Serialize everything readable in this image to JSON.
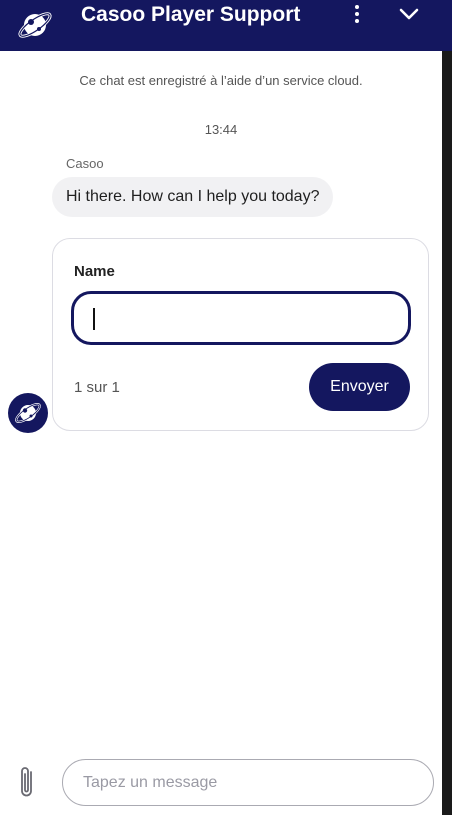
{
  "header": {
    "title": "Casoo Player Support",
    "logo_icon": "planet-logo-icon",
    "menu_icon": "kebab-menu-icon",
    "collapse_icon": "chevron-down-icon",
    "background": "#14175f"
  },
  "chat": {
    "notice": "Ce chat est enregistré à l’aide d’un service cloud.",
    "time": "13:44",
    "sender": "Casoo",
    "message": "Hi there. How can I help you today?",
    "avatar_icon": "planet-logo-icon"
  },
  "form": {
    "label": "Name",
    "input_value": "",
    "pager": "1 sur 1",
    "submit_label": "Envoyer",
    "accent": "#14175f"
  },
  "composer": {
    "placeholder": "Tapez un message",
    "attach_icon": "paperclip-icon"
  }
}
